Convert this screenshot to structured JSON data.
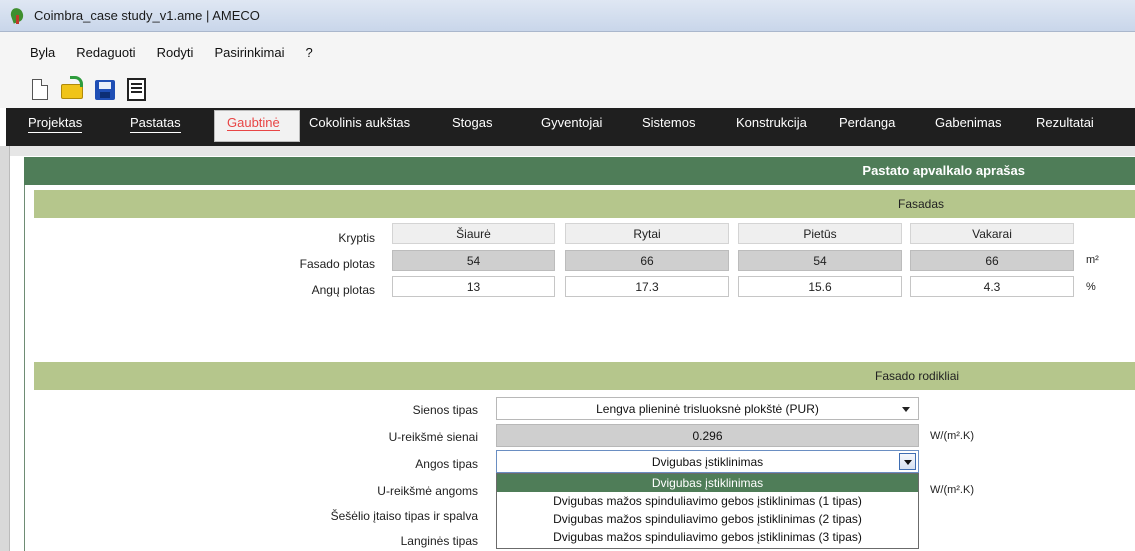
{
  "window": {
    "title": "Coimbra_case study_v1.ame | AMECO"
  },
  "menu": [
    "Byla",
    "Redaguoti",
    "Rodyti",
    "Pasirinkimai",
    "?"
  ],
  "toolbar": [
    "new-file-icon",
    "open-folder-icon",
    "save-icon",
    "report-icon"
  ],
  "tabs": [
    {
      "label": "Projektas",
      "active": false
    },
    {
      "label": "Pastatas",
      "active": false
    },
    {
      "label": "Gaubtinė",
      "active": true
    },
    {
      "label": "Cokolinis aukštas",
      "active": false
    },
    {
      "label": "Stogas",
      "active": false
    },
    {
      "label": "Gyventojai",
      "active": false
    },
    {
      "label": "Sistemos",
      "active": false
    },
    {
      "label": "Konstrukcija",
      "active": false
    },
    {
      "label": "Perdanga",
      "active": false
    },
    {
      "label": "Gabenimas",
      "active": false
    },
    {
      "label": "Rezultatai",
      "active": false
    }
  ],
  "panel": {
    "title": "Pastato apvalkalo aprašas"
  },
  "fasadas": {
    "title": "Fasadas",
    "row_labels": {
      "direction": "Kryptis",
      "facade_area": "Fasado plotas",
      "window_area": "Angų plotas"
    },
    "directions": [
      "Šiaurė",
      "Rytai",
      "Pietūs",
      "Vakarai"
    ],
    "facade_area": [
      "54",
      "66",
      "54",
      "66"
    ],
    "window_area": [
      "13",
      "17.3",
      "15.6",
      "4.3"
    ],
    "units": {
      "area": "m²",
      "percent": "%"
    }
  },
  "rodikliai": {
    "title": "Fasado rodikliai",
    "labels": {
      "wall_type": "Sienos tipas",
      "wall_u": "U-reikšmė sienai",
      "window_type": "Angos tipas",
      "window_u": "U-reikšmė angoms",
      "shading": "Šešėlio įtaiso tipas ir spalva",
      "frame_type": "Langinės tipas"
    },
    "wall_type_value": "Lengva plieninė trisluoksnė plokštė (PUR)",
    "wall_u_value": "0.296",
    "window_type_value": "Dvigubas įstiklinimas",
    "u_unit": "W/(m².K)",
    "window_options": [
      "Dvigubas įstiklinimas",
      "Dvigubas mažos spinduliavimo gebos įstiklinimas (1 tipas)",
      "Dvigubas mažos spinduliavimo gebos įstiklinimas (2 tipas)",
      "Dvigubas mažos spinduliavimo gebos įstiklinimas (3 tipas)"
    ]
  },
  "colors": {
    "panel_green": "#4f7d58",
    "section_green": "#b5c68c",
    "active_tab": "#e84545"
  }
}
